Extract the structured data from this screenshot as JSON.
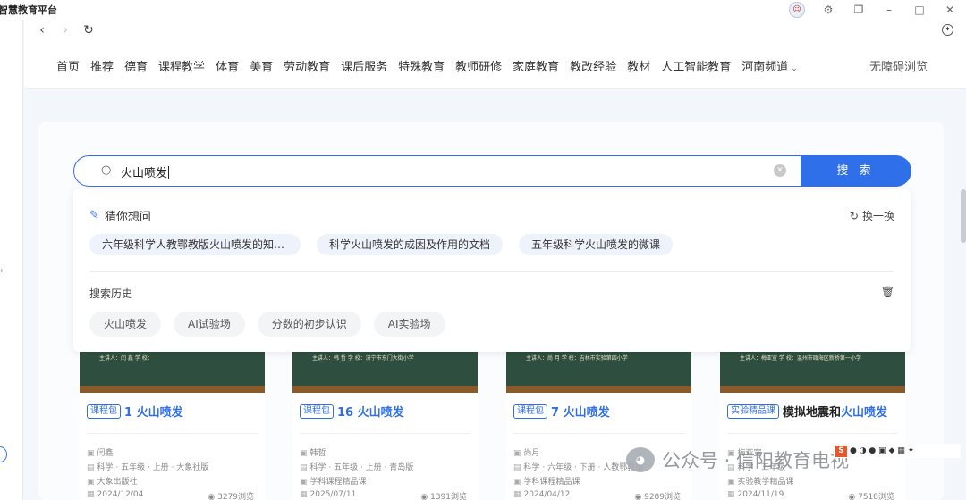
{
  "window": {
    "title": "智慧教育平台"
  },
  "nav_menu": [
    "首页",
    "推荐",
    "德育",
    "课程教学",
    "体育",
    "美育",
    "劳动教育",
    "课后服务",
    "特殊教育",
    "教师研修",
    "家庭教育",
    "教改经验",
    "教材",
    "人工智能教育",
    "河南频道"
  ],
  "accessibility": "无障碍浏览",
  "search": {
    "value": "火山喷发",
    "button": "搜 索"
  },
  "suggest": {
    "title": "猜你想问",
    "refresh": "换一换",
    "items": [
      "六年级科学人教鄂教版火山喷发的知识点",
      "科学火山喷发的成因及作用的文档",
      "五年级科学火山喷发的微课"
    ]
  },
  "history": {
    "title": "搜索历史",
    "items": [
      "火山喷发",
      "AI试验场",
      "分数的初步认识",
      "AI实验场"
    ]
  },
  "cards": [
    {
      "thumb_text": "主讲人：闫 鑫        学 校：",
      "tag": "课程包",
      "title_pre": "1 ",
      "title_hl": "火山喷发",
      "author": "闫鑫",
      "grade": "科学 · 五年级 · 上册 · 大象社版",
      "publisher": "大象出版社",
      "date": "2024/12/04",
      "views": "3279浏览"
    },
    {
      "thumb_text": "主讲人：韩 哲        学 校：济宁市东门大街小学",
      "tag": "课程包",
      "title_pre": "16 ",
      "title_hl": "火山喷发",
      "author": "韩哲",
      "grade": "科学 · 五年级 · 上册 · 青岛版",
      "publisher": "学科课程精品课",
      "date": "2025/07/11",
      "views": "1391浏览"
    },
    {
      "thumb_text": "主讲人：尚 月        学 校：吉林市实验第四小学",
      "tag": "课程包",
      "title_pre": "7 ",
      "title_hl": "火山喷发",
      "author": "尚月",
      "grade": "科学 · 六年级 · 下册 · 人教鄂教版",
      "publisher": "学科课程精品课",
      "date": "2024/04/12",
      "views": "9289浏览"
    },
    {
      "thumb_text": "主讲人：梅亚宣      学 校：温州市瓯海区新桥第一小学",
      "tag": "实验精品课",
      "title_pre": "模拟地震和",
      "title_hl": "火山喷发",
      "author": "梅亚宣",
      "grade": "科学 · 五年级",
      "publisher": "实验教学精品课",
      "date": "2024/11/19",
      "views": "7518浏览"
    }
  ],
  "watermark": "公众号 · 信阳教育电视",
  "colors": {
    "primary": "#2f6fe9",
    "chip_bg": "#eef3fb",
    "board": "#2e4f3f"
  }
}
